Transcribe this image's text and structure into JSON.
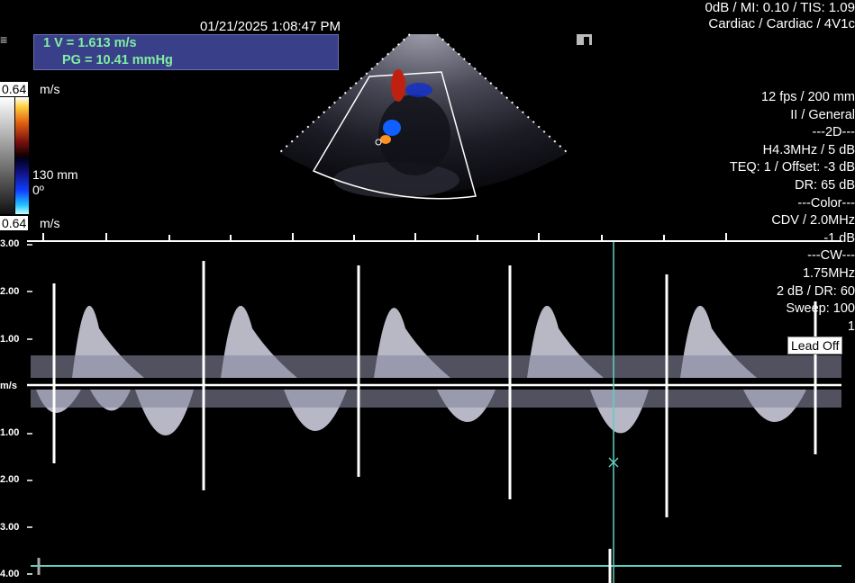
{
  "header": {
    "timestamp": "01/21/2025 1:08:47 PM",
    "line1": "0dB / MI: 0.10 / TIS: 1.09",
    "line2": "Cardiac / Cardiac / 4V1c"
  },
  "measurement": {
    "velocity": "1  V = 1.613 m/s",
    "gradient": "PG = 10.41 mmHg"
  },
  "color_scale": {
    "top_value": "0.64",
    "bottom_value": "0.64",
    "unit": "m/s",
    "depth": "130 mm",
    "angle": "0º"
  },
  "params": [
    "12 fps / 200 mm",
    "II / General",
    "---2D---",
    "H4.3MHz / 5 dB",
    "TEQ: 1 / Offset: -3 dB",
    "DR: 65 dB",
    "---Color---",
    "CDV / 2.0MHz",
    "-1 dB",
    "---CW---",
    "1.75MHz",
    "2 dB / DR: 60",
    "Sweep: 100",
    "1"
  ],
  "lead_off": "Lead Off",
  "spectral": {
    "baseline_label": "m/s",
    "y_ticks": [
      {
        "label": "3.00",
        "value": 3
      },
      {
        "label": "2.00",
        "value": 2
      },
      {
        "label": "1.00",
        "value": 1
      },
      {
        "label": "1.00",
        "value": -1
      },
      {
        "label": "2.00",
        "value": -2
      },
      {
        "label": "3.00",
        "value": -3
      },
      {
        "label": "4.00",
        "value": -4
      }
    ],
    "cursor_velocity": -1.613
  },
  "colors": {
    "cursor": "#5fd0c0",
    "measure_text": "#7ff0a0",
    "measure_bg": "#3a3f8a"
  }
}
